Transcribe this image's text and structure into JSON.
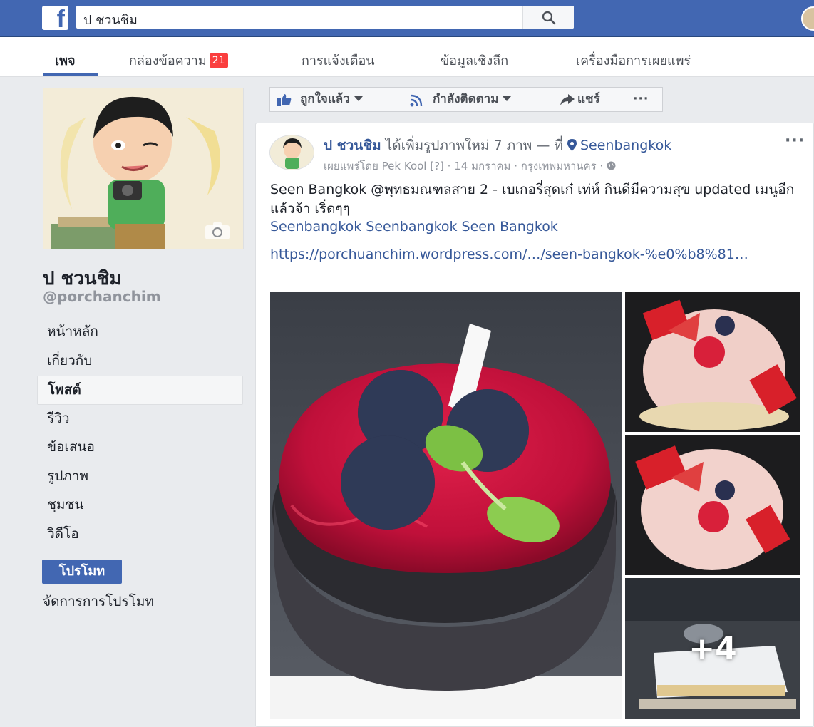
{
  "topbar": {
    "logo": "f",
    "search_value": "ป ชวนชิม",
    "search_icon": "search-icon"
  },
  "tabs": [
    {
      "label": "เพจ",
      "active": true
    },
    {
      "label": "กล่องข้อความ",
      "badge": "21"
    },
    {
      "label": "การแจ้งเตือน"
    },
    {
      "label": "ข้อมูลเชิงลึก"
    },
    {
      "label": "เครื่องมือการเผยแพร่"
    }
  ],
  "page": {
    "name": "ป ชวนชิม",
    "handle": "@porchanchim"
  },
  "nav": [
    {
      "label": "หน้าหลัก"
    },
    {
      "label": "เกี่ยวกับ"
    },
    {
      "label": "โพสต์",
      "selected": true
    },
    {
      "label": "รีวิว"
    },
    {
      "label": "ข้อเสนอ"
    },
    {
      "label": "รูปภาพ"
    },
    {
      "label": "ชุมชน"
    },
    {
      "label": "วิดีโอ"
    }
  ],
  "promote": {
    "button_label": "โปรโมท",
    "manage_label": "จัดการการโปรโมท"
  },
  "actions": {
    "like_label": "ถูกใจแล้ว",
    "follow_label": "กำลังติดตาม",
    "share_label": "แชร์",
    "more_label": "···"
  },
  "post": {
    "author": "ป ชวนชิม",
    "action": " ได้เพิ่มรูปภาพใหม่ 7 ภาพ — ที่ ",
    "location": "Seenbangkok",
    "meta": "เผยแพร่โดย Pek Kool [?] · 14 มกราคม · กรุงเทพมหานคร · ",
    "more": "···",
    "text": "Seen Bangkok @พุทธมณฑลสาย 2 - เบเกอรี่สุดเก๋ เท่ห์ กินดีมีความสุข updated เมนูอีกแล้วจ้า เริ่ดๆๆ",
    "tags": "Seenbangkok Seenbangkok Seen Bangkok",
    "link": "https://porchuanchim.wordpress.com/…/seen-bangkok-%e0%b8%81…",
    "extra_photos": "+4"
  },
  "colors": {
    "brand_blue": "#4267b2",
    "link_blue": "#365899",
    "badge_red": "#fa3e3e"
  }
}
